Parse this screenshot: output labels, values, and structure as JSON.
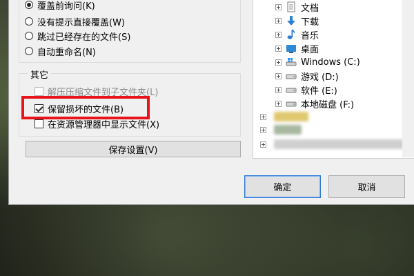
{
  "overwrite_options": [
    {
      "label": "覆盖前询问(K)",
      "selected": true
    },
    {
      "label": "没有提示直接覆盖(W)",
      "selected": false
    },
    {
      "label": "跳过已经存在的文件(S)",
      "selected": false
    },
    {
      "label": "自动重命名(N)",
      "selected": false
    }
  ],
  "other_section": {
    "title": "其它",
    "options": [
      {
        "label": "解压压缩文件到子文件夹(L)",
        "checked": false,
        "enabled": false
      },
      {
        "label": "保留损坏的文件(B)",
        "checked": true,
        "enabled": true
      },
      {
        "label": "在资源管理器中显示文件(X)",
        "checked": false,
        "enabled": true
      }
    ]
  },
  "save_settings_label": "保存设置(V)",
  "folder_tree": [
    {
      "label": "文档",
      "icon": "document-icon"
    },
    {
      "label": "下载",
      "icon": "download-arrow-icon"
    },
    {
      "label": "音乐",
      "icon": "music-note-icon"
    },
    {
      "label": "桌面",
      "icon": "desktop-icon"
    },
    {
      "label": "Windows (C:)",
      "icon": "windows-drive-icon"
    },
    {
      "label": "游戏 (D:)",
      "icon": "drive-icon"
    },
    {
      "label": "软件 (E:)",
      "icon": "drive-icon"
    },
    {
      "label": "本地磁盘 (F:)",
      "icon": "drive-icon"
    }
  ],
  "buttons": {
    "ok": "确定",
    "cancel": "取消"
  },
  "colors": {
    "highlight": "#e8131b",
    "dialog_bg": "#f0f0f0",
    "primary_border": "#2f7ad9"
  }
}
